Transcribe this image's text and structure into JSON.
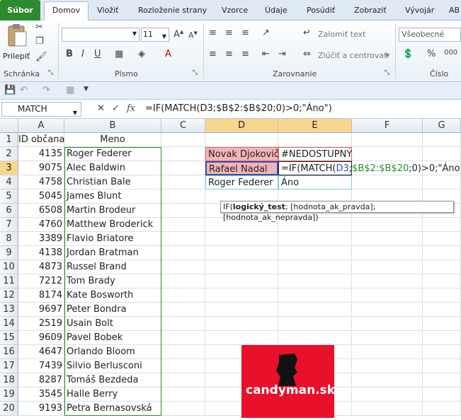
{
  "ribbon_tabs": [
    "Súbor",
    "Domov",
    "Vložiť",
    "Rozloženie strany",
    "Vzorce",
    "Údaje",
    "Posúdiť",
    "Zobraziť",
    "Vývojár",
    "AB"
  ],
  "ribbon": {
    "paste_label": "Prilepiť",
    "clipboard_label": "Schránka",
    "font_size": "11",
    "font_label": "Písmo",
    "wrap_label": "Zalomiť text",
    "merge_label": "Zlúčiť a centrovať",
    "align_label": "Zarovnanie",
    "number_format": "Všeobecné",
    "number_label": "Číslo"
  },
  "formula_bar": {
    "name_box": "MATCH",
    "fx": "fx",
    "formula": "=IF(MATCH(D3;$B$2:$B$20;0)>0;\"Áno\")"
  },
  "columns": [
    "A",
    "B",
    "C",
    "D",
    "E",
    "F",
    "G"
  ],
  "headers": {
    "a": "ID občana",
    "b": "Meno"
  },
  "rows": [
    {
      "n": "1"
    },
    {
      "n": "2",
      "id": "4135",
      "name": "Roger Federer"
    },
    {
      "n": "3",
      "id": "9075",
      "name": "Alec Baldwin"
    },
    {
      "n": "4",
      "id": "4758",
      "name": "Christian Bale"
    },
    {
      "n": "5",
      "id": "5045",
      "name": "James Blunt"
    },
    {
      "n": "6",
      "id": "6508",
      "name": "Martin Brodeur"
    },
    {
      "n": "7",
      "id": "4760",
      "name": "Matthew Broderick"
    },
    {
      "n": "8",
      "id": "3389",
      "name": "Flavio Briatore"
    },
    {
      "n": "9",
      "id": "4138",
      "name": "Jordan Bratman"
    },
    {
      "n": "10",
      "id": "4873",
      "name": "Russel Brand"
    },
    {
      "n": "11",
      "id": "7212",
      "name": "Tom Brady"
    },
    {
      "n": "12",
      "id": "8174",
      "name": "Kate Bosworth"
    },
    {
      "n": "13",
      "id": "9697",
      "name": "Peter Bondra"
    },
    {
      "n": "14",
      "id": "2519",
      "name": "Usain Bolt"
    },
    {
      "n": "15",
      "id": "9609",
      "name": "Pavel Bobek"
    },
    {
      "n": "16",
      "id": "4647",
      "name": "Orlando Bloom"
    },
    {
      "n": "17",
      "id": "7439",
      "name": "Silvio Berlusconi"
    },
    {
      "n": "18",
      "id": "8287",
      "name": "Tomáš Bezdeda"
    },
    {
      "n": "19",
      "id": "3545",
      "name": "Halle Berry"
    },
    {
      "n": "20",
      "id": "9193",
      "name": "Petra Bernasovská"
    }
  ],
  "lookup": {
    "d2": "Novak Djokovič",
    "e2": "#NEDOSTUPNÝ",
    "d3": "Rafael Nadal",
    "e3_a": "=IF(MATCH(",
    "e3_ref": "D3",
    "e3_sep": ";",
    "e3_range": "$B$2:$B$20",
    "e3_tail": ";0)>0;\"Áno\")",
    "d4": "Roger Federer",
    "e4": "Áno"
  },
  "tooltip": {
    "fn": "IF(",
    "arg1": "logický_test",
    "rest": "; [hodnota_ak_pravda]; [hodnota_ak_nepravda])"
  },
  "logo": {
    "text": "candyman.sk"
  }
}
